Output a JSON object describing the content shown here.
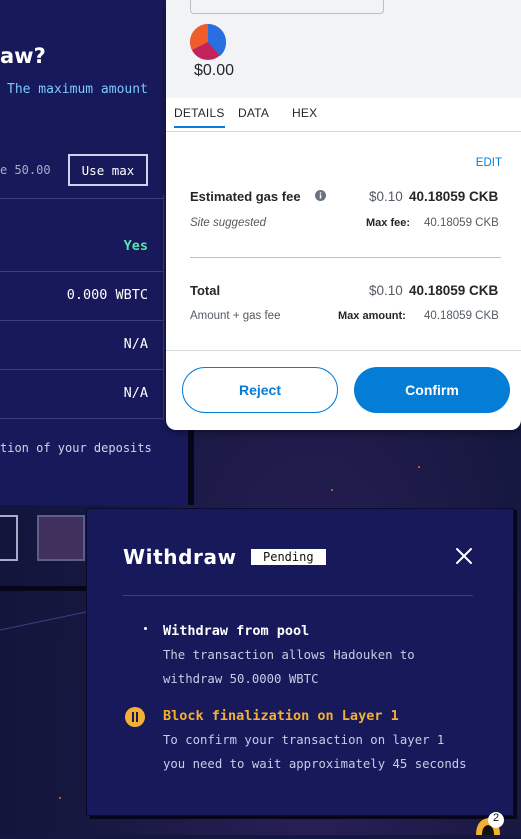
{
  "dapp": {
    "title_fragment": "aw?",
    "hint_fragment": "The maximum amount",
    "amount_fragment": "e 50.00",
    "use_max_label": "Use max",
    "rows": [
      {
        "value": "Yes"
      },
      {
        "value": "0.000 WBTC"
      },
      {
        "value": "N/A"
      },
      {
        "value": "N/A"
      }
    ],
    "deposits_fragment": "tion of your deposits"
  },
  "metamask": {
    "value": "$0.00",
    "tabs": [
      "DETAILS",
      "DATA",
      "HEX"
    ],
    "edit_label": "EDIT",
    "gas": {
      "label": "Estimated gas fee",
      "usd": "$0.10",
      "ckb": "40.18059 CKB",
      "note": "Site suggested",
      "max_label": "Max fee:",
      "max_value": "40.18059 CKB"
    },
    "total": {
      "label": "Total",
      "usd": "$0.10",
      "ckb": "40.18059 CKB",
      "note": "Amount + gas fee",
      "max_label": "Max amount:",
      "max_value": "40.18059 CKB"
    },
    "reject_label": "Reject",
    "confirm_label": "Confirm"
  },
  "withdraw_modal": {
    "title": "Withdraw",
    "status": "Pending",
    "steps": [
      {
        "title": "Withdraw from pool",
        "desc_1": "The transaction allows Hadouken to",
        "desc_2": "withdraw 50.0000 WBTC"
      },
      {
        "title": "Block finalization on Layer 1",
        "desc_1": "To confirm your transaction on layer 1",
        "desc_2": "you need to wait approximately 45 seconds"
      }
    ]
  },
  "notification": {
    "count": "2"
  },
  "colors": {
    "accent": "#037dd6",
    "pending": "#f3b033",
    "success": "#5ce0b1",
    "panel": "#17195a"
  }
}
